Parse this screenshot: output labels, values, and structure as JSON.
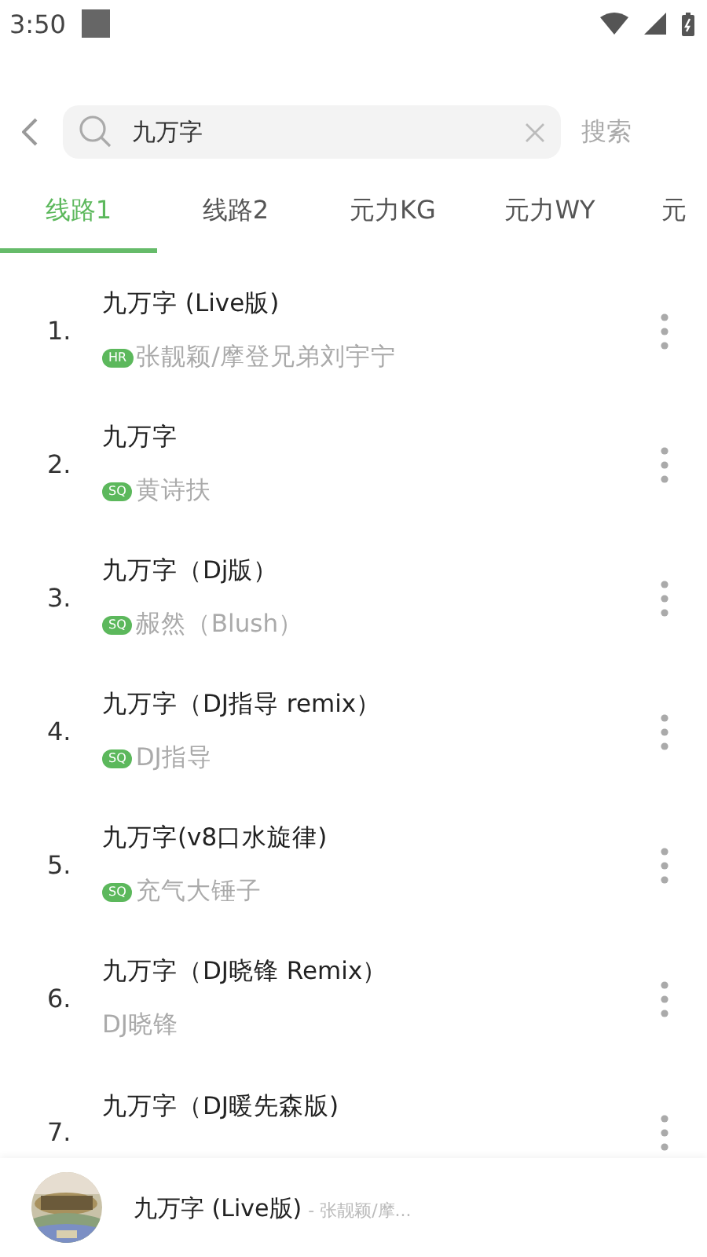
{
  "status_bar": {
    "time": "3:50"
  },
  "search": {
    "value": "九万字",
    "action": "搜索"
  },
  "tabs": [
    {
      "label": "线路1",
      "selected": true
    },
    {
      "label": "线路2",
      "selected": false
    },
    {
      "label": "元力KG",
      "selected": false
    },
    {
      "label": "元力WY",
      "selected": false
    },
    {
      "label": "元",
      "selected": false
    }
  ],
  "songs": [
    {
      "index": "1.",
      "title": "九万字 (Live版)",
      "quality": "HR",
      "artist": "张靓颖/摩登兄弟刘宇宁"
    },
    {
      "index": "2.",
      "title": "九万字",
      "quality": "SQ",
      "artist": "黄诗扶"
    },
    {
      "index": "3.",
      "title": "九万字（Dj版）",
      "quality": "SQ",
      "artist": "赧然（Blush）"
    },
    {
      "index": "4.",
      "title": "九万字（DJ指导 remix）",
      "quality": "SQ",
      "artist": "DJ指导"
    },
    {
      "index": "5.",
      "title": "九万字(v8口水旋律)",
      "quality": "SQ",
      "artist": "充气大锤子"
    },
    {
      "index": "6.",
      "title": "九万字（DJ晓锋 Remix）",
      "artist": "DJ晓锋"
    },
    {
      "index": "7.",
      "title": "九万字（DJ暖先森版)"
    }
  ],
  "player": {
    "title": "九万字 (Live版)",
    "subtitle": "- 张靓颖/摩..."
  }
}
